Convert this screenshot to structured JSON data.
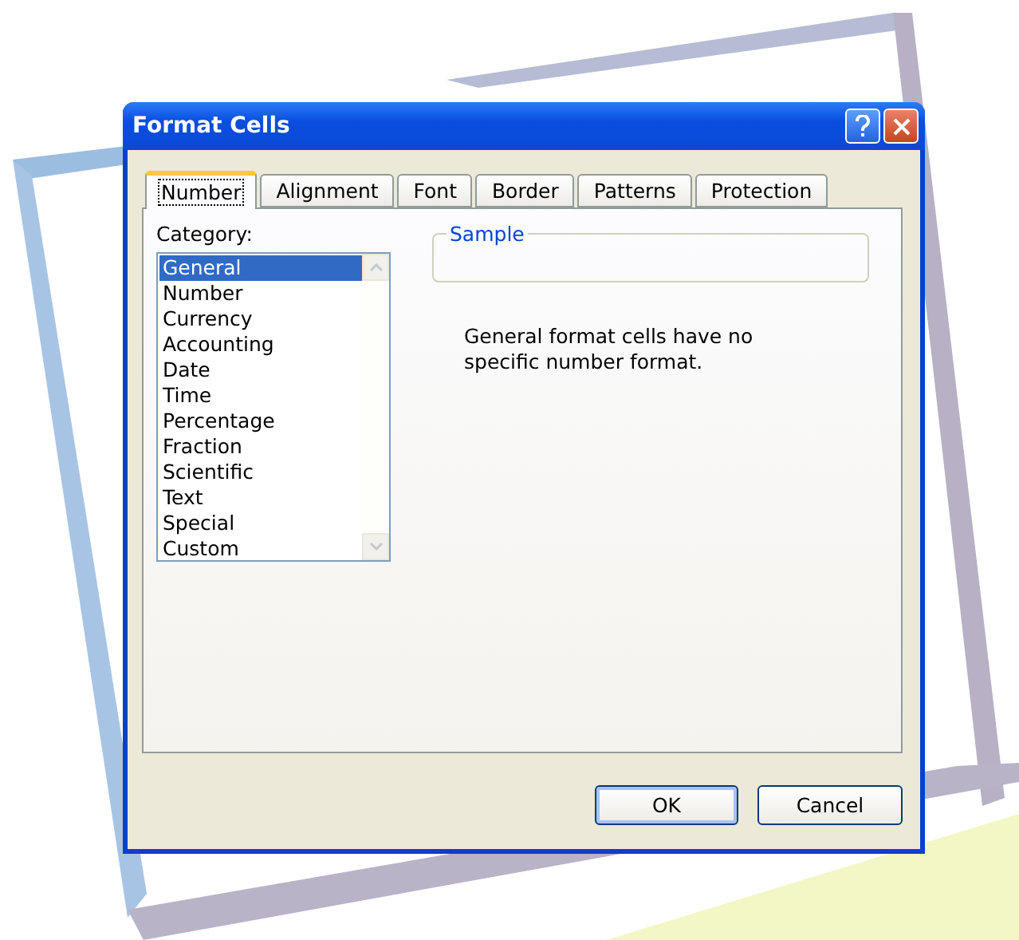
{
  "window": {
    "title": "Format Cells"
  },
  "tabs": [
    {
      "label": "Number",
      "selected": true
    },
    {
      "label": "Alignment",
      "selected": false
    },
    {
      "label": "Font",
      "selected": false
    },
    {
      "label": "Border",
      "selected": false
    },
    {
      "label": "Patterns",
      "selected": false
    },
    {
      "label": "Protection",
      "selected": false
    }
  ],
  "category": {
    "label": "Category:",
    "items": [
      {
        "label": "General",
        "selected": true
      },
      {
        "label": "Number",
        "selected": false
      },
      {
        "label": "Currency",
        "selected": false
      },
      {
        "label": "Accounting",
        "selected": false
      },
      {
        "label": "Date",
        "selected": false
      },
      {
        "label": "Time",
        "selected": false
      },
      {
        "label": "Percentage",
        "selected": false
      },
      {
        "label": "Fraction",
        "selected": false
      },
      {
        "label": "Scientific",
        "selected": false
      },
      {
        "label": "Text",
        "selected": false
      },
      {
        "label": "Special",
        "selected": false
      },
      {
        "label": "Custom",
        "selected": false
      }
    ]
  },
  "sample": {
    "legend": "Sample"
  },
  "description": "General format cells have no specific number format.",
  "buttons": [
    {
      "label": "OK",
      "kind": "default"
    },
    {
      "label": "Cancel",
      "kind": "normal"
    }
  ]
}
